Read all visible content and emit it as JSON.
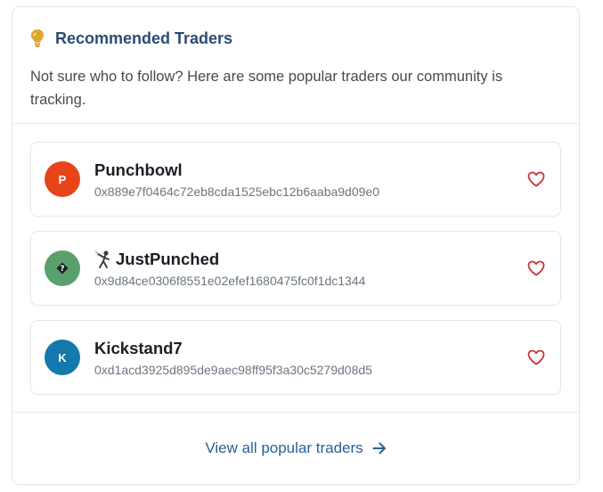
{
  "panel": {
    "title": "Recommended Traders",
    "description": "Not sure who to follow? Here are some popular traders our community is tracking.",
    "title_icon": "lightbulb-icon",
    "title_color": "#2a4c74"
  },
  "traders": [
    {
      "initial": "P",
      "name": "Punchbowl",
      "address": "0x889e7f0464c72eb8cda1525ebc12b6aaba9d09e0",
      "avatar_color": "#e8441a",
      "name_icon": "",
      "favorite_icon": "heart-outline-icon"
    },
    {
      "initial": "�",
      "name": "JustPunched",
      "address": "0x9d84ce0306f8551e02efef1680475fc0f1dc1344",
      "avatar_color": "#5aa06c",
      "name_icon": "fencer-emoji-icon",
      "favorite_icon": "heart-outline-icon"
    },
    {
      "initial": "K",
      "name": "Kickstand7",
      "address": "0xd1acd3925d895de9aec98ff95f3a30c5279d08d5",
      "avatar_color": "#1479ad",
      "name_icon": "",
      "favorite_icon": "heart-outline-icon"
    }
  ],
  "footer": {
    "link_label": "View all popular traders",
    "link_icon": "arrow-right-icon",
    "link_color": "#2a5f96"
  },
  "colors": {
    "heart": "#c8323b"
  }
}
